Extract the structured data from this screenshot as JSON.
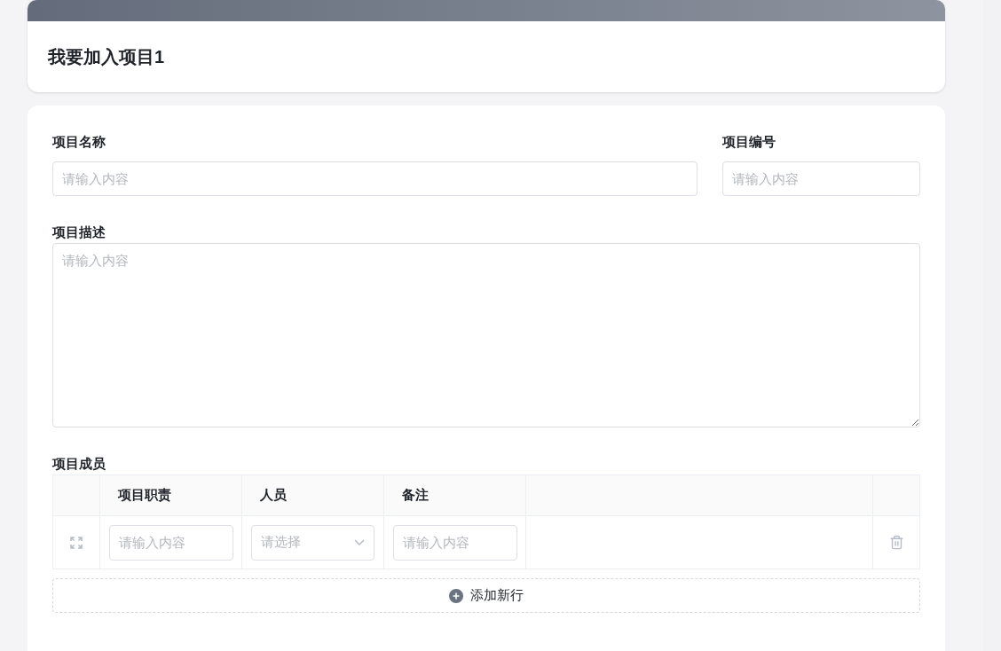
{
  "header": {
    "title": "我要加入项目1"
  },
  "fields": [
    {
      "label": "项目名称",
      "placeholder": "请输入内容"
    },
    {
      "label": "项目编号",
      "placeholder": "请输入内容"
    }
  ],
  "description": {
    "label": "项目描述",
    "placeholder": "请输入内容"
  },
  "members": {
    "label": "项目成员",
    "columns": [
      "项目职责",
      "人员",
      "备注"
    ],
    "rows": [
      {
        "cells": [
          {
            "kind": "input",
            "placeholder": "请输入内容"
          },
          {
            "kind": "select",
            "placeholder": "请选择"
          },
          {
            "kind": "input",
            "placeholder": "请输入内容"
          }
        ]
      }
    ],
    "add_button": "添加新行"
  }
}
